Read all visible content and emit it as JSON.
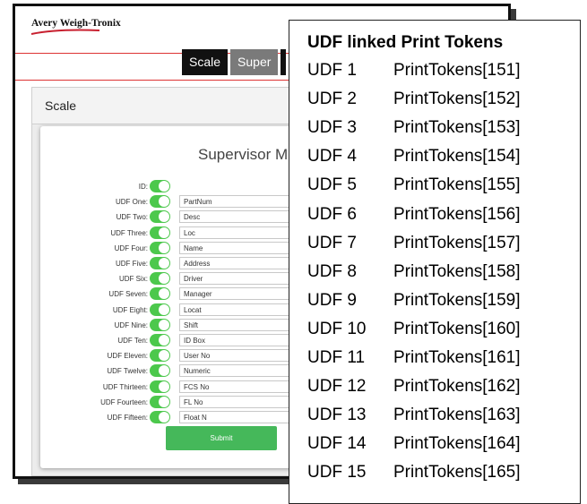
{
  "app": {
    "logo_text": "Avery Weigh-Tronix",
    "tabs": [
      "Scale",
      "Super"
    ],
    "panel_title": "Scale",
    "card_title": "Supervisor M",
    "submit_label": "Submit",
    "toggle_color": "#4cc84c",
    "rows": [
      {
        "label": "ID:",
        "value": null
      },
      {
        "label": "UDF One:",
        "value": "PartNum"
      },
      {
        "label": "UDF Two:",
        "value": "Desc"
      },
      {
        "label": "UDF Three:",
        "value": "Loc"
      },
      {
        "label": "UDF Four:",
        "value": "Name"
      },
      {
        "label": "UDF Five:",
        "value": "Address"
      },
      {
        "label": "UDF Six:",
        "value": "Driver"
      },
      {
        "label": "UDF Seven:",
        "value": "Manager"
      },
      {
        "label": "UDF Eight:",
        "value": "Locat"
      },
      {
        "label": "UDF Nine:",
        "value": "Shift"
      },
      {
        "label": "UDF Ten:",
        "value": "ID Box"
      },
      {
        "label": "UDF Eleven:",
        "value": "User No"
      },
      {
        "label": "UDF Twelve:",
        "value": "Numeric"
      },
      {
        "label": "UDF Thirteen:",
        "value": "FCS No"
      },
      {
        "label": "UDF Fourteen:",
        "value": "FL No"
      },
      {
        "label": "UDF Fifteen:",
        "value": "Float N"
      }
    ]
  },
  "overlay": {
    "title": "UDF linked Print Tokens",
    "tokens": [
      {
        "udf": "UDF 1",
        "token": "PrintTokens[151]"
      },
      {
        "udf": "UDF 2",
        "token": "PrintTokens[152]"
      },
      {
        "udf": "UDF 3",
        "token": "PrintTokens[153]"
      },
      {
        "udf": "UDF 4",
        "token": "PrintTokens[154]"
      },
      {
        "udf": "UDF 5",
        "token": "PrintTokens[155]"
      },
      {
        "udf": "UDF 6",
        "token": "PrintTokens[156]"
      },
      {
        "udf": "UDF 7",
        "token": "PrintTokens[157]"
      },
      {
        "udf": "UDF 8",
        "token": "PrintTokens[158]"
      },
      {
        "udf": "UDF 9",
        "token": "PrintTokens[159]"
      },
      {
        "udf": "UDF 10",
        "token": "PrintTokens[160]"
      },
      {
        "udf": "UDF 11",
        "token": "PrintTokens[161]"
      },
      {
        "udf": "UDF 12",
        "token": "PrintTokens[162]"
      },
      {
        "udf": "UDF 13",
        "token": "PrintTokens[163]"
      },
      {
        "udf": "UDF 14",
        "token": "PrintTokens[164]"
      },
      {
        "udf": "UDF 15",
        "token": "PrintTokens[165]"
      }
    ]
  }
}
